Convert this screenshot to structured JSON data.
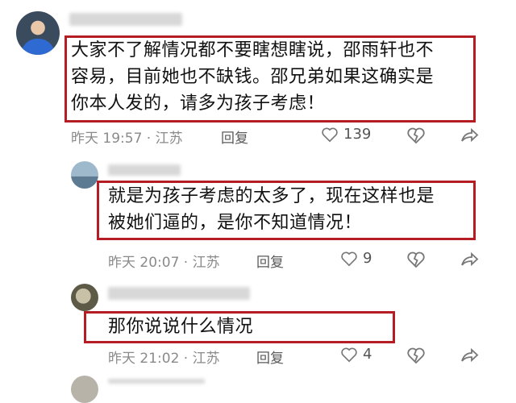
{
  "comments": [
    {
      "text_lines": [
        "大家不了解情况都不要瞎想瞎说，邵雨轩也不",
        "容易，目前她也不缺钱。邵兄弟如果这确实是",
        "你本人发的，请多为孩子考虑！"
      ],
      "time": "昨天 19:57 · 江苏",
      "reply_label": "回复",
      "likes": "139"
    },
    {
      "text_lines": [
        "就是为孩子考虑的太多了，现在这样也是",
        "被她们逼的，是你不知道情况！"
      ],
      "time": "昨天 20:07 · 江苏",
      "reply_label": "回复",
      "likes": "9"
    },
    {
      "text_lines": [
        "那你说说什么情况"
      ],
      "time": "昨天 21:02 · 江苏",
      "reply_label": "回复",
      "likes": "4"
    }
  ],
  "colors": {
    "highlight_border": "#b51d24",
    "meta_text": "#8a8a8a"
  },
  "icons": [
    "heart-icon",
    "dislike-heart-icon",
    "share-icon"
  ]
}
